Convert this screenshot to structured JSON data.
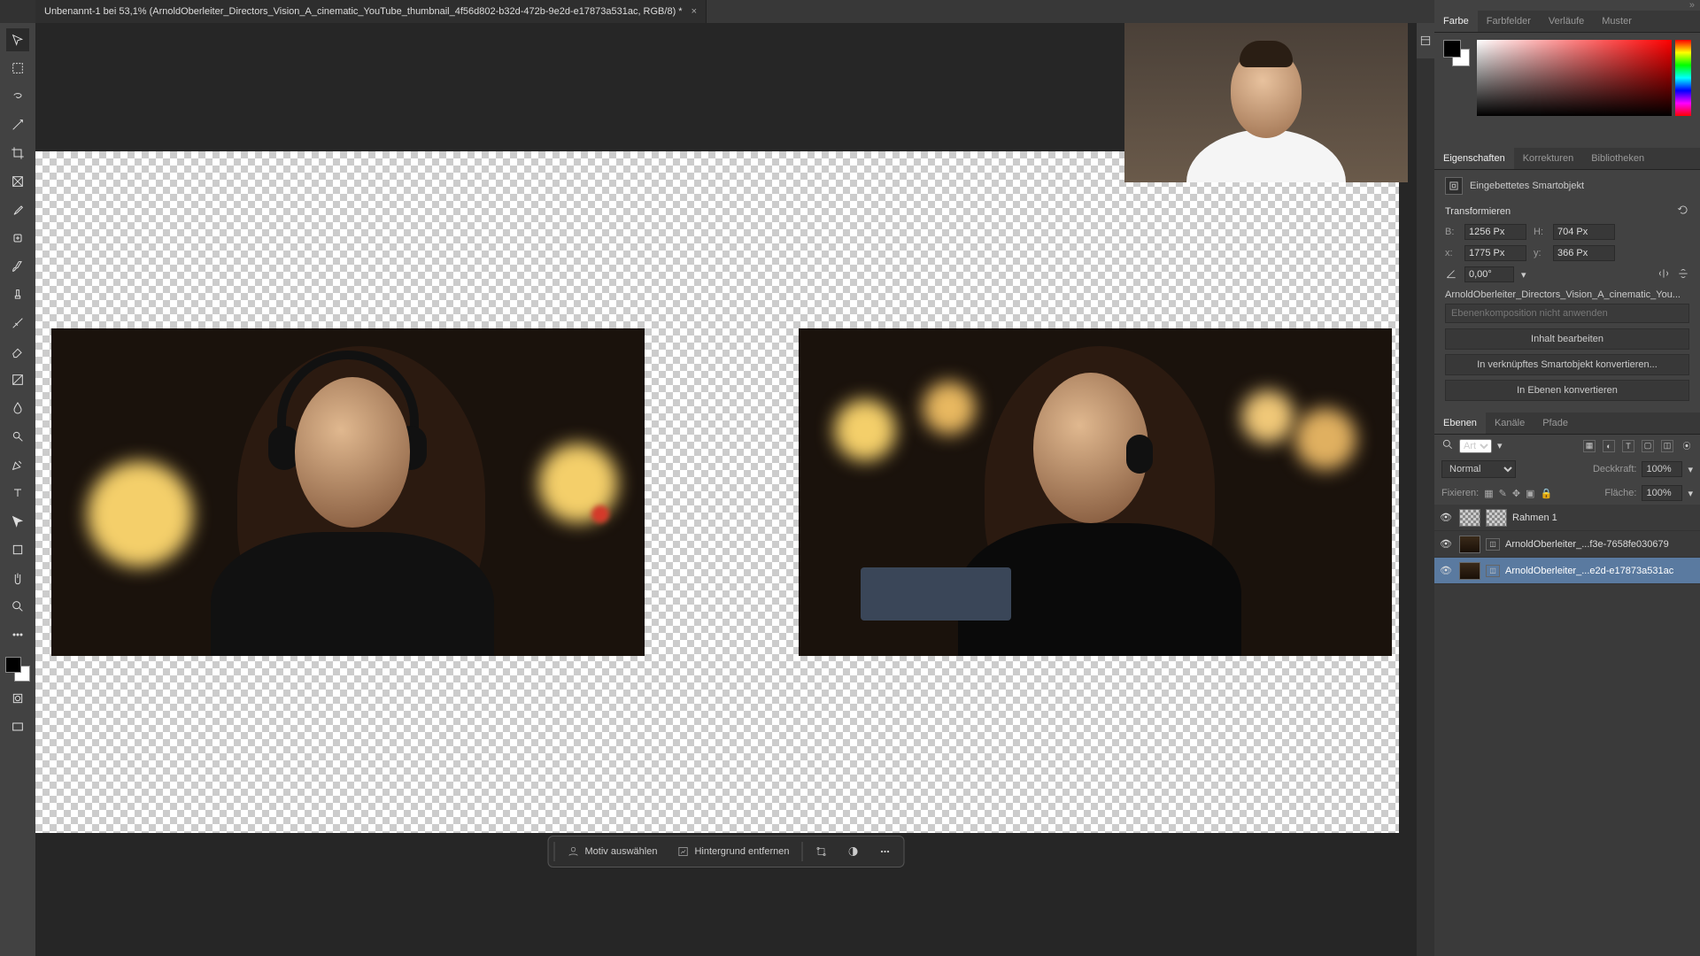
{
  "document": {
    "tab_title": "Unbenannt-1 bei 53,1% (ArnoldOberleiter_Directors_Vision_A_cinematic_YouTube_thumbnail_4f56d802-b32d-472b-9e2d-e17873a531ac, RGB/8) *"
  },
  "context_bar": {
    "select_subject": "Motiv auswählen",
    "remove_bg": "Hintergrund entfernen"
  },
  "color_panel": {
    "tabs": [
      "Farbe",
      "Farbfelder",
      "Verläufe",
      "Muster"
    ]
  },
  "properties_panel": {
    "tabs": [
      "Eigenschaften",
      "Korrekturen",
      "Bibliotheken"
    ],
    "object_type": "Eingebettetes Smartobjekt",
    "section_transform": "Transformieren",
    "w_label": "B:",
    "w_value": "1256 Px",
    "h_label": "H:",
    "h_value": "704 Px",
    "x_label": "x:",
    "x_value": "1775 Px",
    "y_label": "y:",
    "y_value": "366 Px",
    "angle_value": "0,00°",
    "filename": "ArnoldOberleiter_Directors_Vision_A_cinematic_You...",
    "comp_disabled": "Ebenenkomposition nicht anwenden",
    "btn_edit": "Inhalt bearbeiten",
    "btn_convert_linked": "In verknüpftes Smartobjekt konvertieren...",
    "btn_convert_layers": "In Ebenen konvertieren"
  },
  "layers_panel": {
    "tabs": [
      "Ebenen",
      "Kanäle",
      "Pfade"
    ],
    "filter_kind": "Art",
    "blend_mode": "Normal",
    "opacity_label": "Deckkraft:",
    "opacity_value": "100%",
    "lock_label": "Fixieren:",
    "fill_label": "Fläche:",
    "fill_value": "100%",
    "layers": [
      {
        "name": "Rahmen 1",
        "selected": false,
        "frame": true
      },
      {
        "name": "ArnoldOberleiter_...f3e-7658fe030679",
        "selected": false,
        "smart": true
      },
      {
        "name": "ArnoldOberleiter_...e2d-e17873a531ac",
        "selected": true,
        "smart": true
      }
    ]
  }
}
